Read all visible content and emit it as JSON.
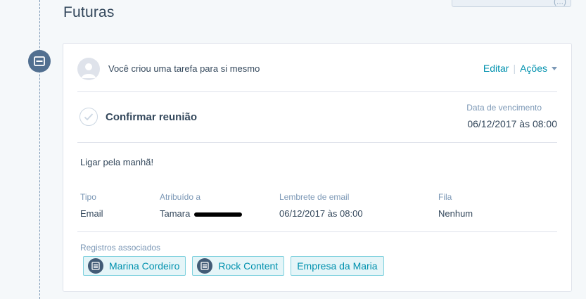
{
  "section": {
    "title": "Futuras",
    "top_button_label": "(...)"
  },
  "card": {
    "header": {
      "text_prefix": "Você criou uma tarefa para ",
      "text_target": "si mesmo",
      "edit_label": "Editar",
      "actions_label": "Ações"
    },
    "task": {
      "title": "Confirmar reunião",
      "due_label": "Data de vencimento",
      "due_value": "06/12/2017 às 08:00"
    },
    "note": "Ligar pela manhã!",
    "meta": {
      "type_label": "Tipo",
      "type_value": "Email",
      "assigned_label": "Atribuído a",
      "assigned_value": "Tamara",
      "reminder_label": "Lembrete de email",
      "reminder_value": "06/12/2017 às 08:00",
      "queue_label": "Fila",
      "queue_value": "Nenhum"
    },
    "associations": {
      "label": "Registros associados",
      "items": [
        {
          "label": "Marina Cordeiro",
          "icon": "record-icon"
        },
        {
          "label": "Rock Content",
          "icon": "record-icon"
        },
        {
          "label": "Empresa da Maria",
          "icon": ""
        }
      ]
    }
  },
  "colors": {
    "accent": "#0091ae",
    "timeline_icon": "#516f90",
    "text": "#33475b",
    "muted": "#7c98b6"
  }
}
